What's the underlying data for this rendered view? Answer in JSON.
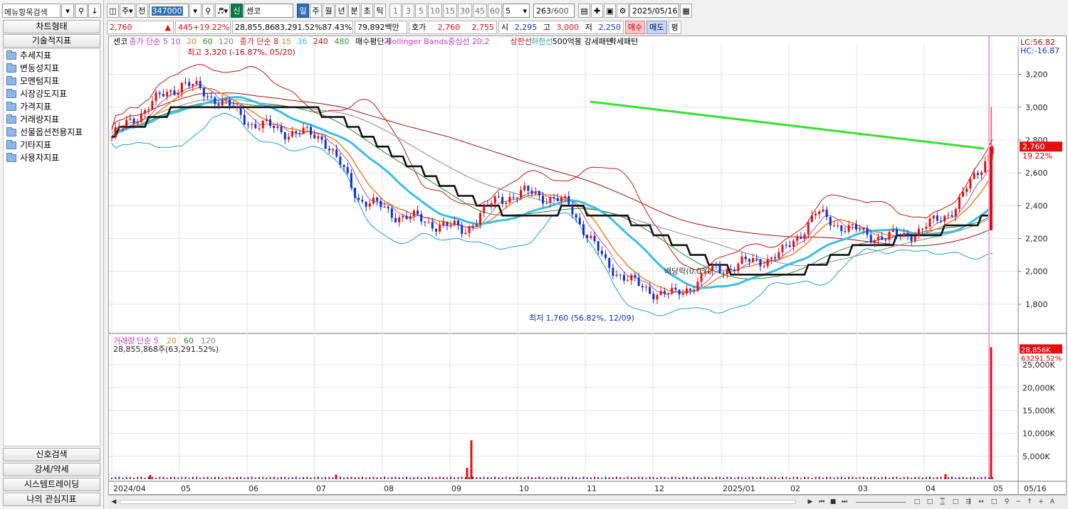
{
  "left_panel": {
    "search_placeholder": "메뉴항목검색",
    "tabs": {
      "chart_type": "차트형태",
      "technical": "기술적지표"
    },
    "tree": [
      "추세지표",
      "변동성지표",
      "모멘텀지표",
      "시장강도지표",
      "가격지표",
      "거래량지표",
      "선물옵션전용지표",
      "기타지표",
      "사용자지표"
    ],
    "bottom_tabs": [
      "신호검색",
      "강세/약세",
      "시스템트레이딩",
      "나의 관심지표"
    ]
  },
  "toolbar": {
    "period_type": "주",
    "jeon": "전",
    "stock_code": "347000",
    "market_badge": "신",
    "stock_name": "센코",
    "periods": [
      "일",
      "주",
      "월",
      "년",
      "분",
      "초",
      "틱"
    ],
    "active_period": "일",
    "minutes": [
      "1",
      "3",
      "5",
      "10",
      "15",
      "30",
      "45",
      "60"
    ],
    "interval_value": "5",
    "count_current": "263",
    "count_total": "/600",
    "date": "2025/05/16"
  },
  "quote": {
    "price": "2,760",
    "change": "445",
    "change_pct": "+19.22%",
    "volume": "28,855,868",
    "volume_pct": "3,291.52%",
    "ratio": "87.43%",
    "amount": "79,892백만",
    "hoga_label": "호가",
    "ask": "2,760",
    "bid": "2,755",
    "open_label": "시",
    "open": "2,295",
    "high_label": "고",
    "high": "3,000",
    "low_label": "저",
    "low": "2,250",
    "buy": "매수",
    "sell": "매도",
    "eval": "평"
  },
  "legend": {
    "name": "센코",
    "sma_label": "종가 단순 5",
    "sma": [
      "10",
      "20",
      "60",
      "120"
    ],
    "ema_label": "종가 단순 8",
    "ema": [
      "15",
      "36",
      "240",
      "480"
    ],
    "avg_cost": "매수평단가",
    "bb": "Bollinger Bands중심선 20,2",
    "upper": "상한선",
    "lower": "하한선",
    "strong": "500억봉 강세패턴",
    "weak": "약세패턴"
  },
  "annotations": {
    "high": "최고 3,320 (-16.87%, 05/20)",
    "low": "최저 1,760 (56.82%, 12/09)",
    "dividend": "배당락(0.0%)"
  },
  "right_info": {
    "lc": "LC:56.82",
    "hc": "HC:-16.87",
    "price_tag": "2,760",
    "pct_tag": "19.22%"
  },
  "volume_legend": {
    "label": "거래량",
    "sma_label": "단순 5",
    "periods": [
      "20",
      "60",
      "120"
    ],
    "value": "28,855,868주(63,291.52%)"
  },
  "volume_tag": {
    "value": "28,856K",
    "pct": "63291.52%"
  },
  "x_axis": {
    "end": "05/16"
  },
  "colors": {
    "up": "#e01010",
    "down": "#1030d0",
    "accent": "#2f6fb6"
  },
  "chart_data": [
    {
      "type": "candlestick",
      "x_ticks": [
        "2024/04",
        "05",
        "06",
        "07",
        "08",
        "09",
        "10",
        "11",
        "12",
        "2025/01",
        "02",
        "03",
        "04",
        "05"
      ],
      "ylim": [
        1700,
        3380
      ],
      "y_ticks": [
        1800,
        2000,
        2200,
        2400,
        2600,
        2800,
        3000,
        3200
      ],
      "close_series": [
        [
          "2024/04",
          2820
        ],
        [
          "05",
          3000
        ],
        [
          "05",
          3150
        ],
        [
          "06",
          3050
        ],
        [
          "06",
          2900
        ],
        [
          "07",
          2850
        ],
        [
          "07",
          2820
        ],
        [
          "08",
          2450
        ],
        [
          "08",
          2350
        ],
        [
          "09",
          2300
        ],
        [
          "09",
          2250
        ],
        [
          "10",
          2450
        ],
        [
          "10",
          2480
        ],
        [
          "11",
          2400
        ],
        [
          "11",
          2050
        ],
        [
          "12",
          1900
        ],
        [
          "12",
          1850
        ],
        [
          "2025/01",
          2000
        ],
        [
          "2025/01",
          2050
        ],
        [
          "02",
          2100
        ],
        [
          "03",
          2350
        ],
        [
          "03",
          2250
        ],
        [
          "04",
          2200
        ],
        [
          "04",
          2250
        ],
        [
          "05",
          2400
        ],
        [
          "05/16",
          2760
        ]
      ],
      "last": 2760,
      "day_high": 3000,
      "day_low": 2250,
      "period_high": 3320,
      "period_low": 1760
    },
    {
      "type": "bar",
      "name": "거래량",
      "y_ticks": [
        "5,000K",
        "10,000K",
        "15,000K",
        "20,000K",
        "25,000K"
      ],
      "ylim": [
        0,
        30000
      ],
      "spikes": [
        [
          "2024/04",
          900
        ],
        [
          "07",
          1000
        ],
        [
          "09",
          8500
        ],
        [
          "09",
          2500
        ],
        [
          "04",
          1100
        ],
        [
          "05/16",
          28856
        ]
      ]
    }
  ]
}
